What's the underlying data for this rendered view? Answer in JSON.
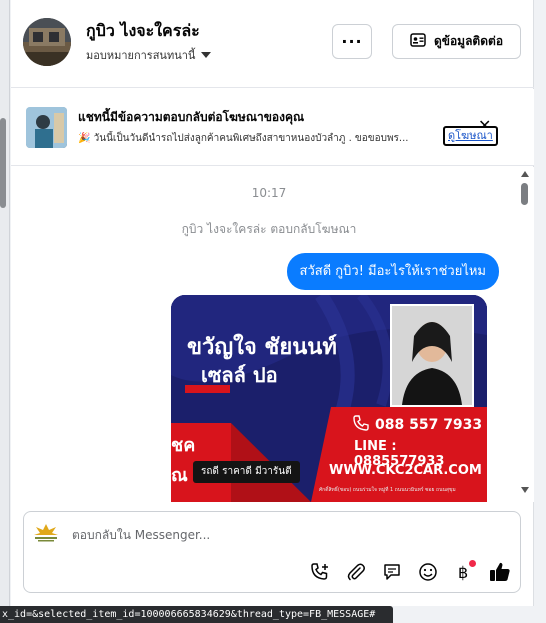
{
  "header": {
    "contact_name": "กูบิว ไงจะใครล่ะ",
    "assign_label": "มอบหมายการสนทนานี้",
    "more_label": "···",
    "contact_info_label": "ดูข้อมูลติดต่อ"
  },
  "ad_banner": {
    "title": "แชทนี้มีข้อความตอบกลับต่อโฆษณาของคุณ",
    "subtitle": "🎉 วันนี้เป็นวันดีนำรถไปส่งลูกค้าคนพิเศษถึงสาขาหนองบัวลำภู . ขอขอบพร...",
    "link_label": "ดูโฆษณา",
    "close_icon": "close-icon"
  },
  "chat": {
    "time": "10:17",
    "system_message": "กูบิว ไงจะใครล่ะ ตอบกลับโฆษณา",
    "outgoing_message": "สวัสดี กูบิว! มีอะไรให้เราช่วยไหม",
    "card": {
      "name": "ขวัญใจ ชัยนนท์",
      "role": "เซลล์ ปอ",
      "phone": "088 557 7933",
      "line": "LINE : 0885577933",
      "website": "WWW.CKC2CAR.COM",
      "tag": "รถดี ราคาดี มีวารันตี",
      "fine_print": "ศักดิ์สิทธิ์(ชอบ) ถนนร่วมใจ หมู่ที่ 1 ถนนนวมินทร์ ซอย ถนนสุขุม",
      "accent_color": "#d8141c",
      "navy_color": "#1b1f6b"
    }
  },
  "composer": {
    "placeholder": "ตอบกลับใน Messenger...",
    "tools": [
      "call-add-icon",
      "attachment-icon",
      "saved-reply-icon",
      "emoji-icon",
      "baht-icon",
      "like-icon"
    ]
  },
  "status_bar": {
    "url": "x_id=&selected_item_id=100006665834629&thread_type=FB_MESSAGE#"
  },
  "colors": {
    "accent": "#0a7cff",
    "notification": "#f02849"
  }
}
